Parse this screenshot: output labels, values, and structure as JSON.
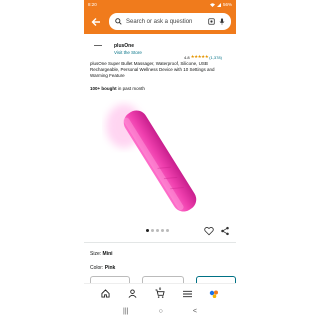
{
  "status_bar": {
    "time": "8:20",
    "battery": "56%"
  },
  "search": {
    "placeholder": "Search or ask a question"
  },
  "brand": {
    "name": "plusOne",
    "store_link": "Visit the Store"
  },
  "rating": {
    "score": "4.8",
    "stars": "★★★★★",
    "count": "(1,378)"
  },
  "product": {
    "title": "plusOne Super Bullet Massager, Waterproof, Silicone, USB Rechargeable, Personal Wellness Device with 10 Settings and Warming Feature",
    "bought_bold": "100+ bought",
    "bought_rest": " in past month",
    "color_hex": "#ef3fae"
  },
  "carousel": {
    "count": 5,
    "active": 0
  },
  "variants": {
    "size_label": "Size: ",
    "size_value": "Mini",
    "color_label": "Color: ",
    "color_value": "Pink"
  },
  "bottom_nav": {
    "items": [
      "home-icon",
      "account-icon",
      "cart-icon",
      "menu-icon",
      "rufus-icon"
    ],
    "cart_count": "0"
  },
  "system_nav": {
    "recents": "|||",
    "home": "○",
    "back": "<"
  }
}
